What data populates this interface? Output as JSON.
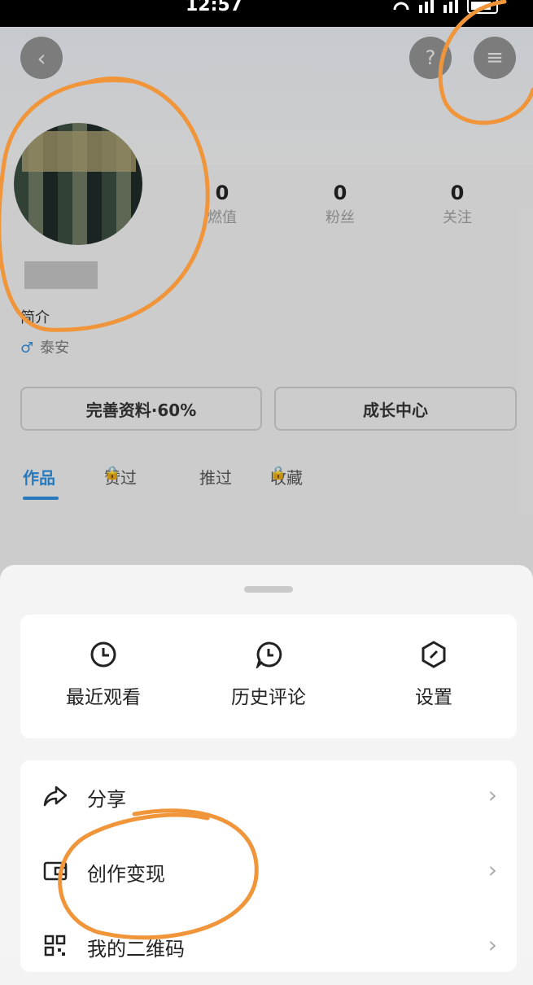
{
  "status_bar": {
    "time": "12:57",
    "icons": "wifi signal signal battery"
  },
  "profile": {
    "stats": [
      {
        "value": "0",
        "label": "燃值"
      },
      {
        "value": "0",
        "label": "粉丝"
      },
      {
        "value": "0",
        "label": "关注"
      }
    ],
    "intro_label": "简介",
    "location": "泰安",
    "complete_button": "完善资料·60%",
    "growth_button": "成长中心",
    "tabs": [
      "作品",
      "赞过",
      "推过",
      "收藏"
    ]
  },
  "sheet": {
    "quick_actions": [
      {
        "icon": "clock-icon",
        "label": "最近观看"
      },
      {
        "icon": "comment-clock-icon",
        "label": "历史评论"
      },
      {
        "icon": "settings-icon",
        "label": "设置"
      }
    ],
    "menu": [
      {
        "icon": "share-icon",
        "label": "分享"
      },
      {
        "icon": "wallet-icon",
        "label": "创作变现"
      },
      {
        "icon": "qrcode-icon",
        "label": "我的二维码"
      }
    ]
  },
  "colors": {
    "accent": "#2e8bd8",
    "annotation": "#f0953a"
  }
}
